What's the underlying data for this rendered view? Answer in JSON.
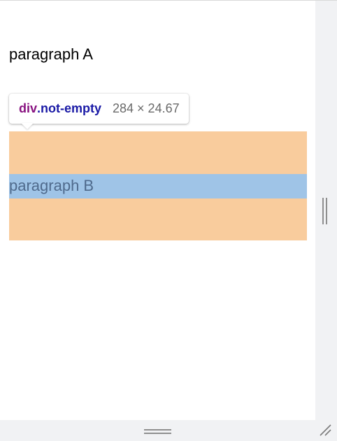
{
  "paragraphs": {
    "a": "paragraph A",
    "b": "paragraph B"
  },
  "inspector_tooltip": {
    "tag": "div",
    "class_selector": ".not-empty",
    "dimensions": "284 × 24.67"
  },
  "icons": {
    "vertical_resize": "vertical-drag-handle-icon",
    "horizontal_resize": "horizontal-drag-handle-icon",
    "corner_resize": "corner-resize-grip-icon"
  },
  "colors": {
    "margin_highlight": "#f9cc9d",
    "content_highlight": "#9fc4e7",
    "tag_color": "#881280",
    "class_color": "#1a1aa6",
    "scroll_track": "#f1f2f4"
  }
}
